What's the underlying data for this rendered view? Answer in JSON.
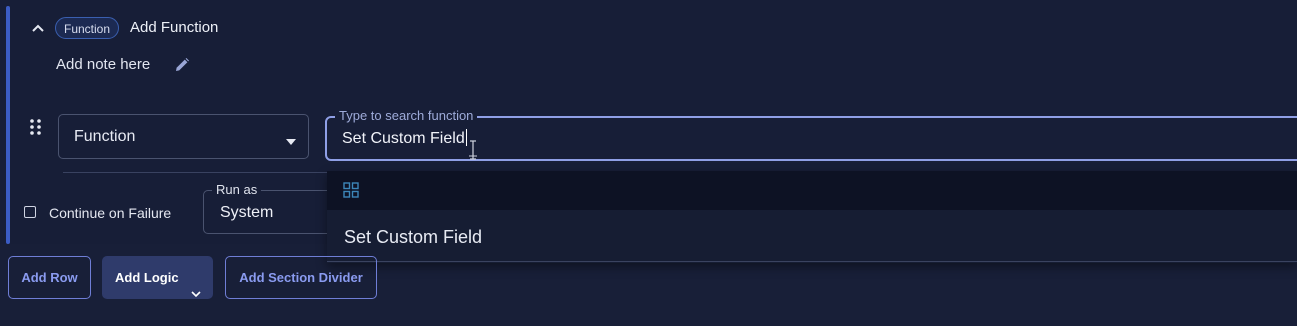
{
  "section": {
    "chip": "Function",
    "title": "Add Function",
    "note": "Add note here"
  },
  "row": {
    "type_select": "Function",
    "search": {
      "legend": "Type to search function",
      "value": "Set Custom Field"
    },
    "continue_on_failure": {
      "label": "Continue on Failure",
      "checked": false
    },
    "run_as": {
      "legend": "Run as",
      "value": "System"
    }
  },
  "dropdown": {
    "options": [
      "Set Custom Field"
    ]
  },
  "footer": {
    "add_row": "Add Row",
    "add_logic": "Add Logic",
    "add_section_divider": "Add Section Divider"
  },
  "colors": {
    "background": "#181f38",
    "accent": "#3b5cc4",
    "focus_border": "#8f9fe6",
    "button_text": "#8a9bf0"
  },
  "icons": [
    "chevron-up-icon",
    "pencil-icon",
    "drag-handle-icon",
    "caret-down-icon",
    "text-cursor-icon",
    "grid-icon",
    "chevron-down-icon"
  ]
}
